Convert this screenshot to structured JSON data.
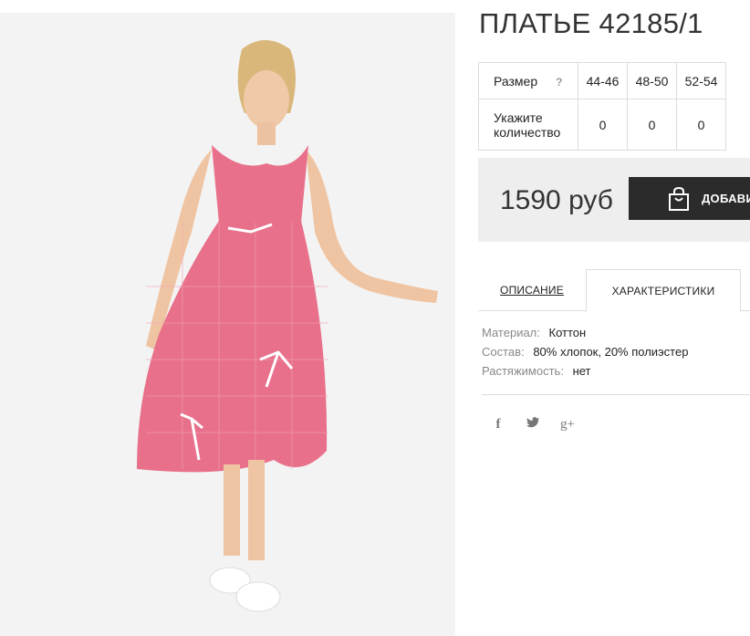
{
  "product": {
    "title": "ПЛАТЬЕ 42185/1",
    "price": "1590 руб",
    "add_button_label": "ДОБАВИТЬ"
  },
  "size_table": {
    "size_label": "Размер",
    "help_mark": "?",
    "qty_label": "Укажите количество",
    "sizes": [
      "44-46",
      "48-50",
      "52-54"
    ],
    "quantities": [
      "0",
      "0",
      "0"
    ]
  },
  "tabs": {
    "description": "ОПИСАНИЕ",
    "specs": "ХАРАКТЕРИСТИКИ"
  },
  "specs": [
    {
      "key": "Материал:",
      "value": "Коттон"
    },
    {
      "key": "Состав:",
      "value": "80% хлопок, 20% полиэстер"
    },
    {
      "key": "Растяжимость:",
      "value": "нет"
    }
  ],
  "social": {
    "facebook": "f",
    "twitter": "🐦",
    "google_plus": "g+"
  },
  "colors": {
    "dress_pink": "#e8708a",
    "button_dark": "#2b2b2b",
    "price_box_bg": "#eeeeee"
  }
}
